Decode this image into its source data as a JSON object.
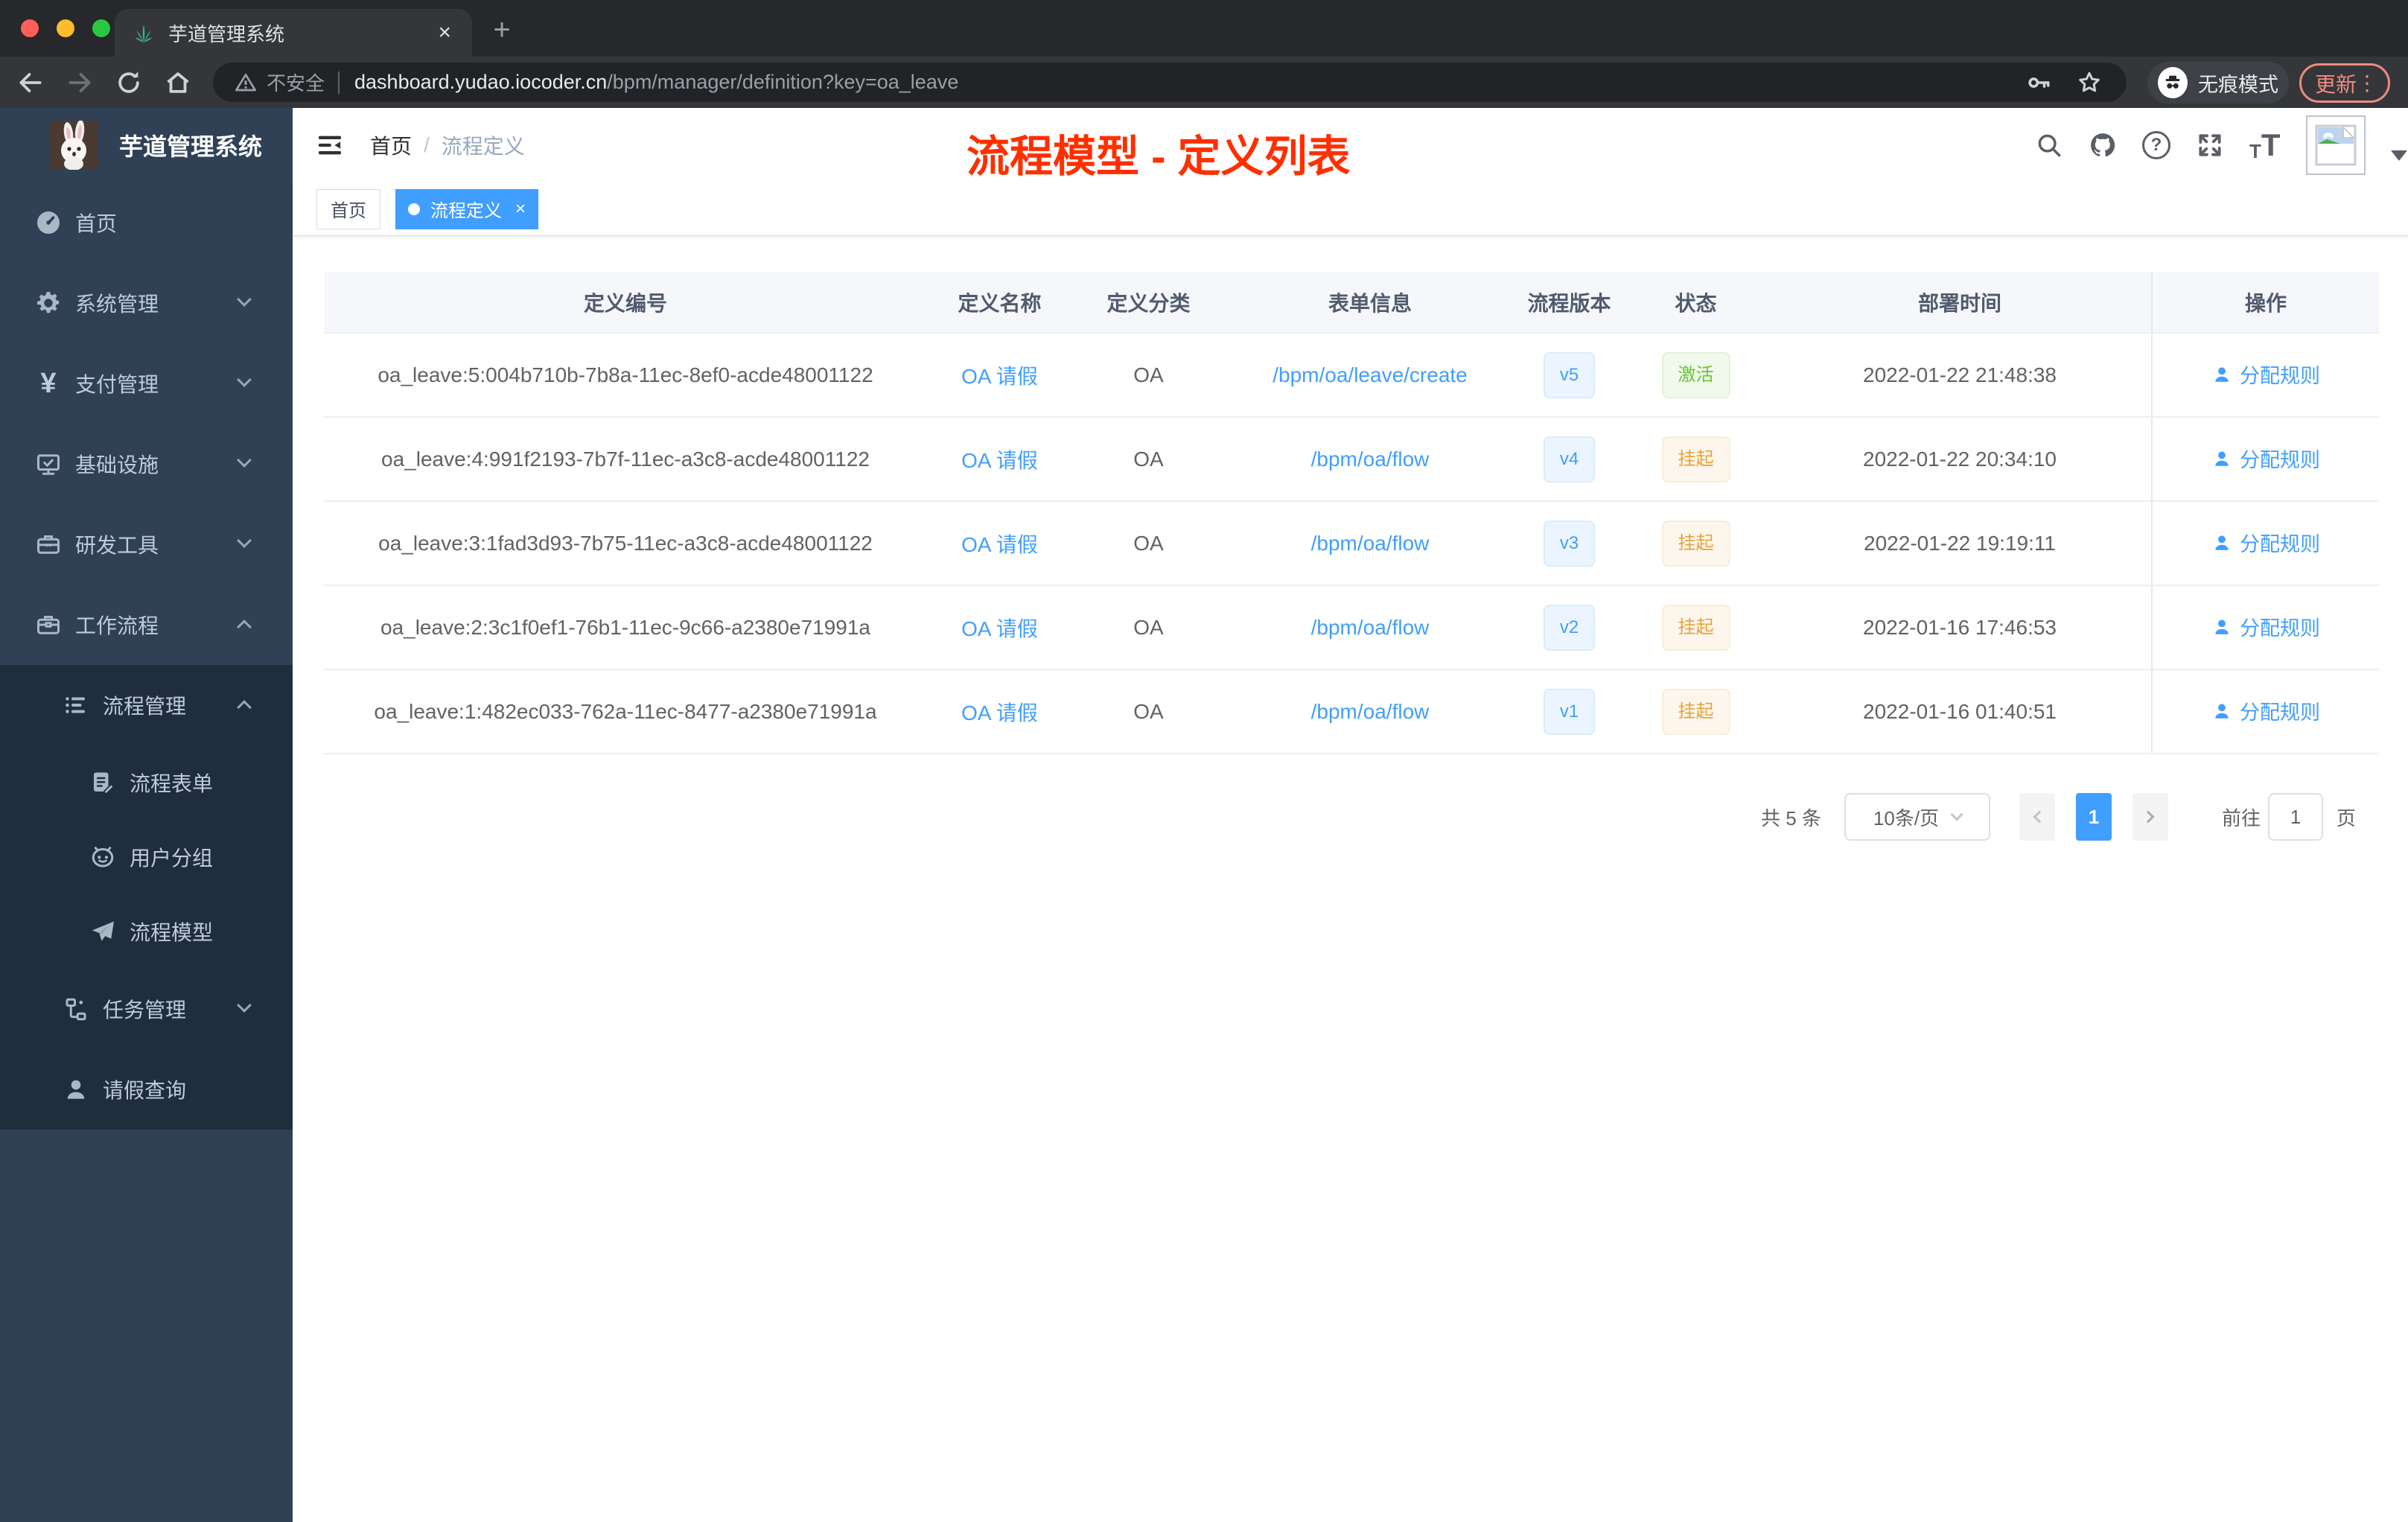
{
  "colors": {
    "accent": "#409eff",
    "success": "#67c23a",
    "warning": "#e6a23c",
    "annotation_red": "#ff2f00",
    "sidebar_bg": "#304156",
    "sidebar_submenu_bg": "#1f2d3d",
    "chrome_bg": "#35363a",
    "update_accent": "#ef8b7e"
  },
  "browser": {
    "tab_title": "芋道管理系统",
    "close_icon": "×",
    "new_tab_icon": "+",
    "security_label": "不安全",
    "url_host": "dashboard.yudao.iocoder.cn",
    "url_path": "/bpm/manager/definition?key=oa_leave",
    "incognito_label": "无痕模式",
    "update_label": "更新",
    "menu_icon": "⋮"
  },
  "sidebar": {
    "app_title": "芋道管理系统",
    "home": "首页",
    "system": "系统管理",
    "payment": "支付管理",
    "infra": "基础设施",
    "devtools": "研发工具",
    "workflow": "工作流程",
    "process_mgmt": "流程管理",
    "process_form": "流程表单",
    "user_group": "用户分组",
    "process_model": "流程模型",
    "task_mgmt": "任务管理",
    "leave_query": "请假查询"
  },
  "navbar": {
    "breadcrumb_home": "首页",
    "breadcrumb_sep": "/",
    "breadcrumb_current": "流程定义",
    "help_glyph": "?",
    "font_icon_small": "T",
    "font_icon_big": "T"
  },
  "annotation": {
    "text": "流程模型 - 定义列表"
  },
  "tags": {
    "home": "首页",
    "current": "流程定义",
    "close_icon": "×"
  },
  "table": {
    "headers": [
      "定义编号",
      "定义名称",
      "定义分类",
      "表单信息",
      "流程版本",
      "状态",
      "部署时间",
      "操作"
    ],
    "rows": [
      {
        "id": "oa_leave:5:004b710b-7b8a-11ec-8ef0-acde48001122",
        "name": "OA 请假",
        "category": "OA",
        "form": "/bpm/oa/leave/create",
        "version": "v5",
        "status": "激活",
        "status_type": "success",
        "deploy_time": "2022-01-22 21:48:38",
        "action": "分配规则"
      },
      {
        "id": "oa_leave:4:991f2193-7b7f-11ec-a3c8-acde48001122",
        "name": "OA 请假",
        "category": "OA",
        "form": "/bpm/oa/flow",
        "version": "v4",
        "status": "挂起",
        "status_type": "warning",
        "deploy_time": "2022-01-22 20:34:10",
        "action": "分配规则"
      },
      {
        "id": "oa_leave:3:1fad3d93-7b75-11ec-a3c8-acde48001122",
        "name": "OA 请假",
        "category": "OA",
        "form": "/bpm/oa/flow",
        "version": "v3",
        "status": "挂起",
        "status_type": "warning",
        "deploy_time": "2022-01-22 19:19:11",
        "action": "分配规则"
      },
      {
        "id": "oa_leave:2:3c1f0ef1-76b1-11ec-9c66-a2380e71991a",
        "name": "OA 请假",
        "category": "OA",
        "form": "/bpm/oa/flow",
        "version": "v2",
        "status": "挂起",
        "status_type": "warning",
        "deploy_time": "2022-01-16 17:46:53",
        "action": "分配规则"
      },
      {
        "id": "oa_leave:1:482ec033-762a-11ec-8477-a2380e71991a",
        "name": "OA 请假",
        "category": "OA",
        "form": "/bpm/oa/flow",
        "version": "v1",
        "status": "挂起",
        "status_type": "warning",
        "deploy_time": "2022-01-16 01:40:51",
        "action": "分配规则"
      }
    ]
  },
  "pagination": {
    "total": "共 5 条",
    "page_size": "10条/页",
    "current_page": "1",
    "goto_label": "前往",
    "goto_value": "1",
    "page_unit": "页"
  }
}
